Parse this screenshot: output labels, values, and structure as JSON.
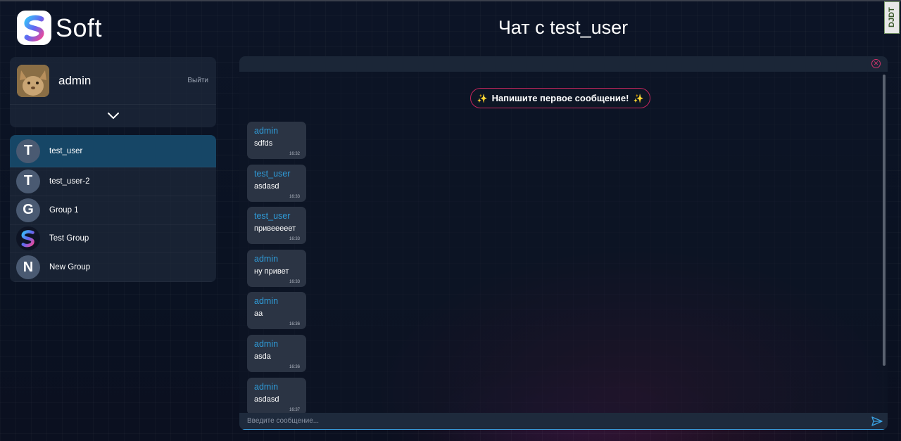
{
  "app": {
    "logo_text": "Soft",
    "debug_toolbar_label": "DJDT"
  },
  "header": {
    "title": "Чат с test_user"
  },
  "profile": {
    "name": "admin",
    "logout_label": "Выйти",
    "avatar_icon": "cat-photo",
    "expand_icon": "chevron-down-icon"
  },
  "chats": [
    {
      "initial": "T",
      "name": "test_user",
      "active": true
    },
    {
      "initial": "T",
      "name": "test_user-2",
      "active": false
    },
    {
      "initial": "G",
      "name": "Group 1",
      "active": false
    },
    {
      "initial": "",
      "name": "Test Group",
      "active": false,
      "icon": "soft-logo"
    },
    {
      "initial": "N",
      "name": "New Group",
      "active": false
    }
  ],
  "chat": {
    "first_message_prompt": "Напишите первое сообщение!",
    "messages": [
      {
        "author": "admin",
        "text": "sdfds",
        "time": "16:32"
      },
      {
        "author": "test_user",
        "text": "asdasd",
        "time": "16:33"
      },
      {
        "author": "test_user",
        "text": "привееееет",
        "time": "16:33"
      },
      {
        "author": "admin",
        "text": "ну привет",
        "time": "16:33"
      },
      {
        "author": "admin",
        "text": "aa",
        "time": "16:36"
      },
      {
        "author": "admin",
        "text": "asda",
        "time": "16:36"
      },
      {
        "author": "admin",
        "text": "asdasd",
        "time": "16:37"
      }
    ],
    "input_placeholder": "Введите сообщение...",
    "input_value": ""
  },
  "colors": {
    "accent": "#2f9bd8",
    "active_chat": "#164666",
    "danger": "#d6336c",
    "background": "#0c1426"
  }
}
